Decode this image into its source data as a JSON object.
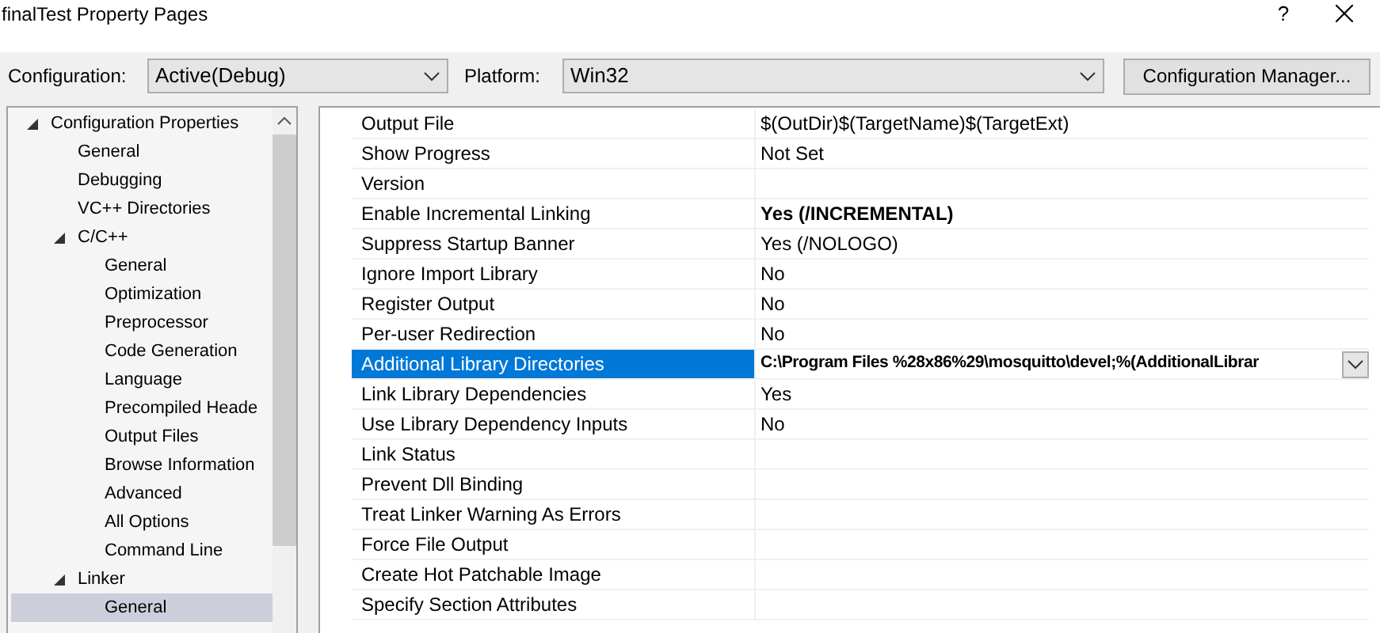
{
  "window": {
    "title": "finalTest Property Pages",
    "help": "?"
  },
  "toolbar": {
    "configuration_label": "Configuration:",
    "configuration": "Active(Debug)",
    "platform_label": "Platform:",
    "platform": "Win32",
    "manager_button": "Configuration Manager..."
  },
  "tree": [
    {
      "label": "Configuration Properties",
      "expanded": true,
      "selected": false,
      "children": [
        {
          "label": "General",
          "selected": false
        },
        {
          "label": "Debugging",
          "selected": false
        },
        {
          "label": "VC++ Directories",
          "selected": false
        },
        {
          "label": "C/C++",
          "expanded": true,
          "selected": false,
          "children": [
            {
              "label": "General",
              "selected": false
            },
            {
              "label": "Optimization",
              "selected": false
            },
            {
              "label": "Preprocessor",
              "selected": false
            },
            {
              "label": "Code Generation",
              "selected": false
            },
            {
              "label": "Language",
              "selected": false
            },
            {
              "label": "Precompiled Heade",
              "selected": false
            },
            {
              "label": "Output Files",
              "selected": false
            },
            {
              "label": "Browse Information",
              "selected": false
            },
            {
              "label": "Advanced",
              "selected": false
            },
            {
              "label": "All Options",
              "selected": false
            },
            {
              "label": "Command Line",
              "selected": false
            }
          ]
        },
        {
          "label": "Linker",
          "expanded": true,
          "selected": false,
          "children": [
            {
              "label": "General",
              "selected": true
            }
          ]
        }
      ]
    }
  ],
  "properties": [
    {
      "name": "Output File",
      "value": "$(OutDir)$(TargetName)$(TargetExt)",
      "bold": false,
      "selected": false
    },
    {
      "name": "Show Progress",
      "value": "Not Set",
      "bold": false,
      "selected": false
    },
    {
      "name": "Version",
      "selected": false
    },
    {
      "name": "Enable Incremental Linking",
      "value": "Yes (/INCREMENTAL)",
      "bold": true,
      "selected": false
    },
    {
      "name": "Suppress Startup Banner",
      "value": "Yes (/NOLOGO)",
      "bold": false,
      "selected": false
    },
    {
      "name": "Ignore Import Library",
      "value": "No",
      "bold": false,
      "selected": false
    },
    {
      "name": "Register Output",
      "value": "No",
      "bold": false,
      "selected": false
    },
    {
      "name": "Per-user Redirection",
      "value": "No",
      "bold": false,
      "selected": false
    },
    {
      "name": "Additional Library Directories",
      "value": "C:\\Program Files %28x86%29\\mosquitto\\devel;%(AdditionalLibrar",
      "bold": true,
      "selected": true
    },
    {
      "name": "Link Library Dependencies",
      "value": "Yes",
      "bold": false,
      "selected": false
    },
    {
      "name": "Use Library Dependency Inputs",
      "value": "No",
      "bold": false,
      "selected": false
    },
    {
      "name": "Link Status",
      "selected": false
    },
    {
      "name": "Prevent Dll Binding",
      "selected": false
    },
    {
      "name": "Treat Linker Warning As Errors",
      "selected": false
    },
    {
      "name": "Force File Output",
      "selected": false
    },
    {
      "name": "Create Hot Patchable Image",
      "selected": false
    },
    {
      "name": "Specify Section Attributes",
      "selected": false
    }
  ]
}
